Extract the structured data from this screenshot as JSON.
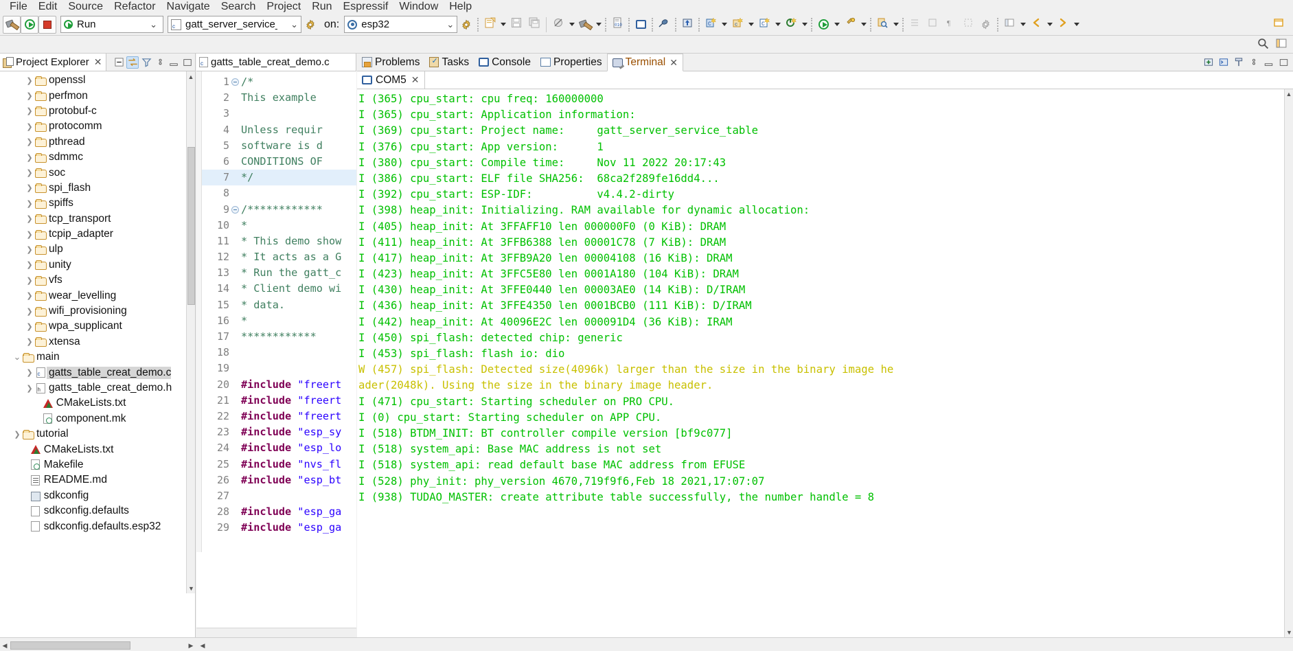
{
  "menubar": {
    "items": [
      "File",
      "Edit",
      "Source",
      "Refactor",
      "Navigate",
      "Search",
      "Project",
      "Run",
      "Espressif",
      "Window",
      "Help"
    ]
  },
  "toolbar": {
    "build_icon": "hammer-icon",
    "run_icon": "run-icon",
    "stop_icon": "stop-icon",
    "launch_mode": "Run",
    "launch_config": "gatt_server_service_ta",
    "on_label": "on:",
    "target": "esp32",
    "icons": [
      "new-file-icon",
      "save-icon",
      "save-all-icon",
      "skip-breakpoints-icon",
      "build-icon",
      "hex-icon",
      "console-icon",
      "debug-icon",
      "open-terminal-icon",
      "new-c-class-icon",
      "new-c-project-icon",
      "new-c-file-icon",
      "goto-icon",
      "search-icon",
      "perspective-icon",
      "back-icon",
      "forward-icon",
      "restore-icon",
      "minimize-icon"
    ]
  },
  "project_explorer": {
    "title": "Project Explorer",
    "close_icon": "close-icon",
    "tools": [
      "collapse-all-icon",
      "link-with-editor-icon",
      "filter-icon",
      "view-menu-icon",
      "minimize-icon",
      "maximize-icon"
    ],
    "tree": [
      {
        "label": "openssl",
        "icon": "folder-icon",
        "arrow": "collapsed",
        "indent": 2,
        "selected": false
      },
      {
        "label": "perfmon",
        "icon": "folder-icon",
        "arrow": "collapsed",
        "indent": 2,
        "selected": false
      },
      {
        "label": "protobuf-c",
        "icon": "folder-icon",
        "arrow": "collapsed",
        "indent": 2,
        "selected": false
      },
      {
        "label": "protocomm",
        "icon": "folder-icon",
        "arrow": "collapsed",
        "indent": 2,
        "selected": false
      },
      {
        "label": "pthread",
        "icon": "folder-icon",
        "arrow": "collapsed",
        "indent": 2,
        "selected": false
      },
      {
        "label": "sdmmc",
        "icon": "folder-icon",
        "arrow": "collapsed",
        "indent": 2,
        "selected": false
      },
      {
        "label": "soc",
        "icon": "folder-icon",
        "arrow": "collapsed",
        "indent": 2,
        "selected": false
      },
      {
        "label": "spi_flash",
        "icon": "folder-icon",
        "arrow": "collapsed",
        "indent": 2,
        "selected": false
      },
      {
        "label": "spiffs",
        "icon": "folder-icon",
        "arrow": "collapsed",
        "indent": 2,
        "selected": false
      },
      {
        "label": "tcp_transport",
        "icon": "folder-icon",
        "arrow": "collapsed",
        "indent": 2,
        "selected": false
      },
      {
        "label": "tcpip_adapter",
        "icon": "folder-icon",
        "arrow": "collapsed",
        "indent": 2,
        "selected": false
      },
      {
        "label": "ulp",
        "icon": "folder-icon",
        "arrow": "collapsed",
        "indent": 2,
        "selected": false
      },
      {
        "label": "unity",
        "icon": "folder-icon",
        "arrow": "collapsed",
        "indent": 2,
        "selected": false
      },
      {
        "label": "vfs",
        "icon": "folder-icon",
        "arrow": "collapsed",
        "indent": 2,
        "selected": false
      },
      {
        "label": "wear_levelling",
        "icon": "folder-icon",
        "arrow": "collapsed",
        "indent": 2,
        "selected": false
      },
      {
        "label": "wifi_provisioning",
        "icon": "folder-icon",
        "arrow": "collapsed",
        "indent": 2,
        "selected": false
      },
      {
        "label": "wpa_supplicant",
        "icon": "folder-icon",
        "arrow": "collapsed",
        "indent": 2,
        "selected": false
      },
      {
        "label": "xtensa",
        "icon": "folder-icon",
        "arrow": "collapsed",
        "indent": 2,
        "selected": false
      },
      {
        "label": "main",
        "icon": "folder-icon",
        "arrow": "expanded",
        "indent": 1,
        "selected": false
      },
      {
        "label": "gatts_table_creat_demo.c",
        "icon": "c-file-icon",
        "arrow": "collapsed",
        "indent": 2,
        "selected": true
      },
      {
        "label": "gatts_table_creat_demo.h",
        "icon": "h-file-icon",
        "arrow": "collapsed",
        "indent": 2,
        "selected": false
      },
      {
        "label": "CMakeLists.txt",
        "icon": "cmake-icon",
        "arrow": "none",
        "indent": 2.6,
        "selected": false
      },
      {
        "label": "component.mk",
        "icon": "makefile-icon",
        "arrow": "none",
        "indent": 2.6,
        "selected": false
      },
      {
        "label": "tutorial",
        "icon": "folder-icon",
        "arrow": "collapsed",
        "indent": 1,
        "selected": false
      },
      {
        "label": "CMakeLists.txt",
        "icon": "cmake-icon",
        "arrow": "none",
        "indent": 1.6,
        "selected": false
      },
      {
        "label": "Makefile",
        "icon": "makefile-icon",
        "arrow": "none",
        "indent": 1.6,
        "selected": false
      },
      {
        "label": "README.md",
        "icon": "markdown-icon",
        "arrow": "none",
        "indent": 1.6,
        "selected": false
      },
      {
        "label": "sdkconfig",
        "icon": "config-icon",
        "arrow": "none",
        "indent": 1.6,
        "selected": false
      },
      {
        "label": "sdkconfig.defaults",
        "icon": "text-file-icon",
        "arrow": "none",
        "indent": 1.6,
        "selected": false
      },
      {
        "label": "sdkconfig.defaults.esp32",
        "icon": "text-file-icon",
        "arrow": "none",
        "indent": 1.6,
        "selected": false
      }
    ]
  },
  "editor": {
    "tab_label": "gatts_table_creat_demo.c",
    "tab_icon": "c-file-icon",
    "close_icon": "close-icon",
    "lines": [
      {
        "num": "1",
        "fold": true,
        "text": "/*",
        "style": "cmt",
        "hl": false
      },
      {
        "num": "2",
        "fold": false,
        "text": "   This example ",
        "style": "cmt",
        "hl": false
      },
      {
        "num": "3",
        "fold": false,
        "text": "",
        "style": "cmt",
        "hl": false
      },
      {
        "num": "4",
        "fold": false,
        "text": "   Unless requir",
        "style": "cmt",
        "hl": false
      },
      {
        "num": "5",
        "fold": false,
        "text": "   software is d",
        "style": "cmt",
        "hl": false
      },
      {
        "num": "6",
        "fold": false,
        "text": "   CONDITIONS OF",
        "style": "cmt",
        "hl": false
      },
      {
        "num": "7",
        "fold": false,
        "text": "*/",
        "style": "cmt",
        "hl": true
      },
      {
        "num": "8",
        "fold": false,
        "text": "",
        "style": "cmt",
        "hl": false
      },
      {
        "num": "9",
        "fold": true,
        "text": "/************",
        "style": "cmt",
        "hl": false
      },
      {
        "num": "10",
        "fold": false,
        "text": "*",
        "style": "cmt",
        "hl": false
      },
      {
        "num": "11",
        "fold": false,
        "text": "* This demo show",
        "style": "cmt",
        "hl": false
      },
      {
        "num": "12",
        "fold": false,
        "text": "* It acts as a G",
        "style": "cmt",
        "hl": false
      },
      {
        "num": "13",
        "fold": false,
        "text": "* Run the gatt_c",
        "style": "cmt",
        "hl": false
      },
      {
        "num": "14",
        "fold": false,
        "text": "* Client demo wi",
        "style": "cmt",
        "hl": false
      },
      {
        "num": "15",
        "fold": false,
        "text": "* data.",
        "style": "cmt",
        "hl": false
      },
      {
        "num": "16",
        "fold": false,
        "text": "*",
        "style": "cmt",
        "hl": false
      },
      {
        "num": "17",
        "fold": false,
        "text": "************",
        "style": "cmt",
        "hl": false
      },
      {
        "num": "18",
        "fold": false,
        "text": "",
        "style": "cmt",
        "hl": false
      },
      {
        "num": "19",
        "fold": false,
        "text": "",
        "style": "cmt",
        "hl": false
      },
      {
        "num": "20",
        "fold": false,
        "pp": "#include",
        "str": " \"freert",
        "style": "mix",
        "hl": false
      },
      {
        "num": "21",
        "fold": false,
        "pp": "#include",
        "str": " \"freert",
        "style": "mix",
        "hl": false
      },
      {
        "num": "22",
        "fold": false,
        "pp": "#include",
        "str": " \"freert",
        "style": "mix",
        "hl": false
      },
      {
        "num": "23",
        "fold": false,
        "pp": "#include",
        "str": " \"esp_sy",
        "style": "mix",
        "hl": false
      },
      {
        "num": "24",
        "fold": false,
        "pp": "#include",
        "str": " \"esp_lo",
        "style": "mix",
        "hl": false
      },
      {
        "num": "25",
        "fold": false,
        "pp": "#include",
        "str": " \"nvs_fl",
        "style": "mix",
        "hl": false
      },
      {
        "num": "26",
        "fold": false,
        "pp": "#include",
        "str": " \"esp_bt",
        "style": "mix",
        "hl": false
      },
      {
        "num": "27",
        "fold": false,
        "pp": "",
        "str": "",
        "style": "mix",
        "hl": false
      },
      {
        "num": "28",
        "fold": false,
        "pp": "#include",
        "str": " \"esp_ga",
        "style": "mix",
        "hl": false
      },
      {
        "num": "29",
        "fold": false,
        "pp": "#include",
        "str": " \"esp_ga",
        "style": "mix",
        "hl": false
      }
    ]
  },
  "bottom_view": {
    "tabs": [
      {
        "label": "Problems",
        "icon": "problems-icon",
        "active": false
      },
      {
        "label": "Tasks",
        "icon": "tasks-icon",
        "active": false
      },
      {
        "label": "Console",
        "icon": "console-icon",
        "active": false
      },
      {
        "label": "Properties",
        "icon": "properties-icon",
        "active": false
      },
      {
        "label": "Terminal",
        "icon": "terminal-icon",
        "active": true
      }
    ],
    "tools": [
      "new-terminal-icon",
      "toggle-terminal-icon",
      "pin-icon",
      "view-menu-icon",
      "minimize-icon",
      "maximize-icon"
    ],
    "terminal_tab": {
      "label": "COM5",
      "icon": "serial-port-icon",
      "close_icon": "close-icon"
    },
    "log": [
      {
        "level": "I",
        "text": "I (365) cpu_start: cpu freq: 160000000"
      },
      {
        "level": "I",
        "text": "I (365) cpu_start: Application information:"
      },
      {
        "level": "I",
        "text": "I (369) cpu_start: Project name:     gatt_server_service_table"
      },
      {
        "level": "I",
        "text": "I (376) cpu_start: App version:      1"
      },
      {
        "level": "I",
        "text": "I (380) cpu_start: Compile time:     Nov 11 2022 20:17:43"
      },
      {
        "level": "I",
        "text": "I (386) cpu_start: ELF file SHA256:  68ca2f289fe16dd4..."
      },
      {
        "level": "I",
        "text": "I (392) cpu_start: ESP-IDF:          v4.4.2-dirty"
      },
      {
        "level": "I",
        "text": "I (398) heap_init: Initializing. RAM available for dynamic allocation:"
      },
      {
        "level": "I",
        "text": "I (405) heap_init: At 3FFAFF10 len 000000F0 (0 KiB): DRAM"
      },
      {
        "level": "I",
        "text": "I (411) heap_init: At 3FFB6388 len 00001C78 (7 KiB): DRAM"
      },
      {
        "level": "I",
        "text": "I (417) heap_init: At 3FFB9A20 len 00004108 (16 KiB): DRAM"
      },
      {
        "level": "I",
        "text": "I (423) heap_init: At 3FFC5E80 len 0001A180 (104 KiB): DRAM"
      },
      {
        "level": "I",
        "text": "I (430) heap_init: At 3FFE0440 len 00003AE0 (14 KiB): D/IRAM"
      },
      {
        "level": "I",
        "text": "I (436) heap_init: At 3FFE4350 len 0001BCB0 (111 KiB): D/IRAM"
      },
      {
        "level": "I",
        "text": "I (442) heap_init: At 40096E2C len 000091D4 (36 KiB): IRAM"
      },
      {
        "level": "I",
        "text": "I (450) spi_flash: detected chip: generic"
      },
      {
        "level": "I",
        "text": "I (453) spi_flash: flash io: dio"
      },
      {
        "level": "W",
        "text": "W (457) spi_flash: Detected size(4096k) larger than the size in the binary image he"
      },
      {
        "level": "W",
        "text": "ader(2048k). Using the size in the binary image header."
      },
      {
        "level": "I",
        "text": "I (471) cpu_start: Starting scheduler on PRO CPU."
      },
      {
        "level": "I",
        "text": "I (0) cpu_start: Starting scheduler on APP CPU."
      },
      {
        "level": "I",
        "text": "I (518) BTDM_INIT: BT controller compile version [bf9c077]"
      },
      {
        "level": "I",
        "text": "I (518) system_api: Base MAC address is not set"
      },
      {
        "level": "I",
        "text": "I (518) system_api: read default base MAC address from EFUSE"
      },
      {
        "level": "I",
        "text": "I (528) phy_init: phy_version 4670,719f9f6,Feb 18 2021,17:07:07"
      },
      {
        "level": "I",
        "text": "I (938) TUDAO_MASTER: create attribute table successfully, the number handle = 8"
      }
    ]
  },
  "colors": {
    "log_info": "#00c000",
    "log_warn": "#c8c000",
    "comment": "#3f7f5f",
    "preprocessor": "#7f0055",
    "string": "#2a00ff",
    "selection": "#e2effb",
    "tab_active_text": "#9a4f00"
  }
}
